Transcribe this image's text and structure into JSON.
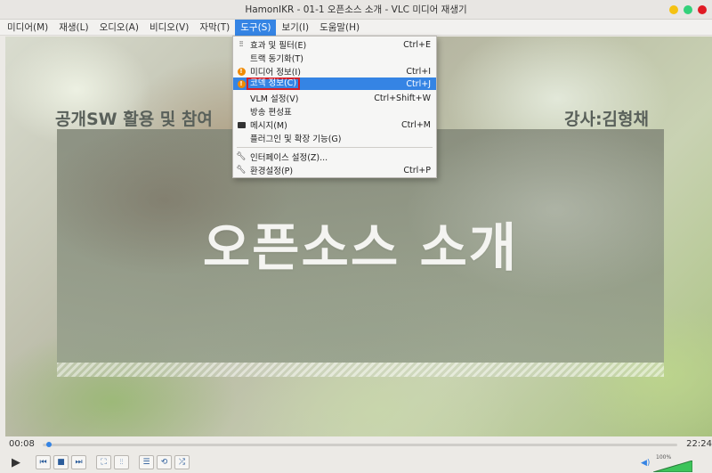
{
  "window": {
    "title": "HamonIKR - 01-1  오픈소스 소개 - VLC 미디어 재생기",
    "buttons": {
      "minimize_color": "#f5c211",
      "maximize_color": "#33d17a",
      "close_color": "#e01b24"
    }
  },
  "menubar": [
    {
      "label": "미디어(M)"
    },
    {
      "label": "재생(L)"
    },
    {
      "label": "오디오(A)"
    },
    {
      "label": "비디오(V)"
    },
    {
      "label": "자막(T)"
    },
    {
      "label": "도구(S)",
      "active": true
    },
    {
      "label": "보기(I)"
    },
    {
      "label": "도움말(H)"
    }
  ],
  "tools_menu": {
    "items": [
      {
        "icon": "equalizer-icon",
        "label": "효과 및 필터(E)",
        "shortcut": "Ctrl+E"
      },
      {
        "icon": "",
        "label": "트랙 동기화(T)",
        "shortcut": ""
      },
      {
        "icon": "info-icon",
        "label": "미디어 정보(I)",
        "shortcut": "Ctrl+I"
      },
      {
        "icon": "info-icon",
        "label": "코덱 정보(C)",
        "shortcut": "Ctrl+J",
        "highlighted": true
      },
      {
        "icon": "",
        "label": "VLM 설정(V)",
        "shortcut": "Ctrl+Shift+W"
      },
      {
        "icon": "",
        "label": "방송 편성표",
        "shortcut": ""
      },
      {
        "icon": "terminal-icon",
        "label": "메시지(M)",
        "shortcut": "Ctrl+M"
      },
      {
        "icon": "",
        "label": "플러그인 및 확장 기능(G)",
        "shortcut": ""
      },
      {
        "icon": "wrench-icon",
        "label": "인터페이스 설정(Z)...",
        "shortcut": ""
      },
      {
        "icon": "wrench-icon",
        "label": "환경설정(P)",
        "shortcut": "Ctrl+P"
      }
    ],
    "highlight_color": "#3584e4"
  },
  "video": {
    "slide_left_text": "공개SW 활용 및 참여",
    "slide_right_text": "강사:김형채",
    "slide_title": "오픈소스 소개"
  },
  "playback": {
    "elapsed": "00:08",
    "total": "22:24",
    "progress": 0.006,
    "volume_label": "100%",
    "volume_level": 1.0
  },
  "controls": {
    "play": "play-icon",
    "prev": "previous-icon",
    "stop": "stop-icon",
    "next": "next-icon",
    "fullscreen": "fullscreen-icon",
    "extended": "equalizer-icon",
    "playlist": "playlist-icon",
    "loop": "loop-icon",
    "shuffle": "shuffle-icon"
  }
}
